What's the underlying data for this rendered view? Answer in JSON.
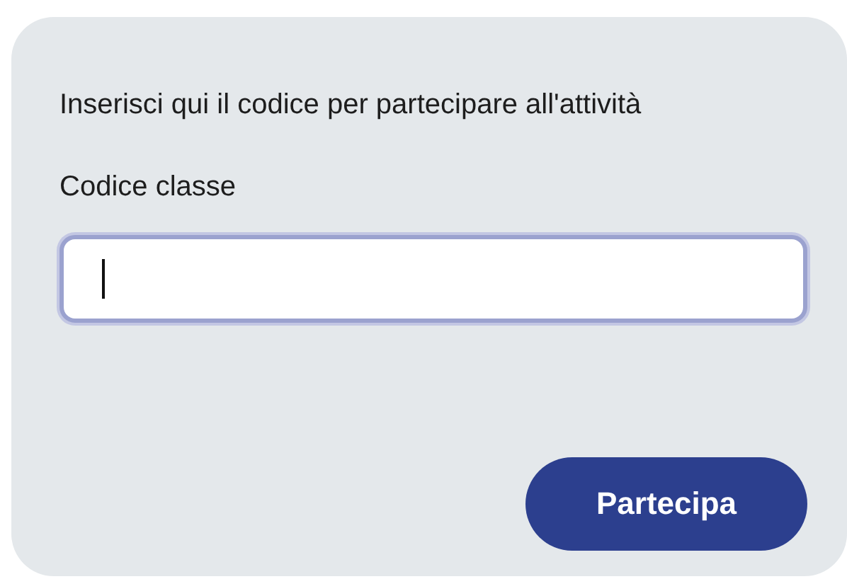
{
  "prompt": "Inserisci qui il codice per partecipare all'attività",
  "field": {
    "label": "Codice classe",
    "focused": true
  },
  "button": {
    "label": "Partecipa"
  }
}
